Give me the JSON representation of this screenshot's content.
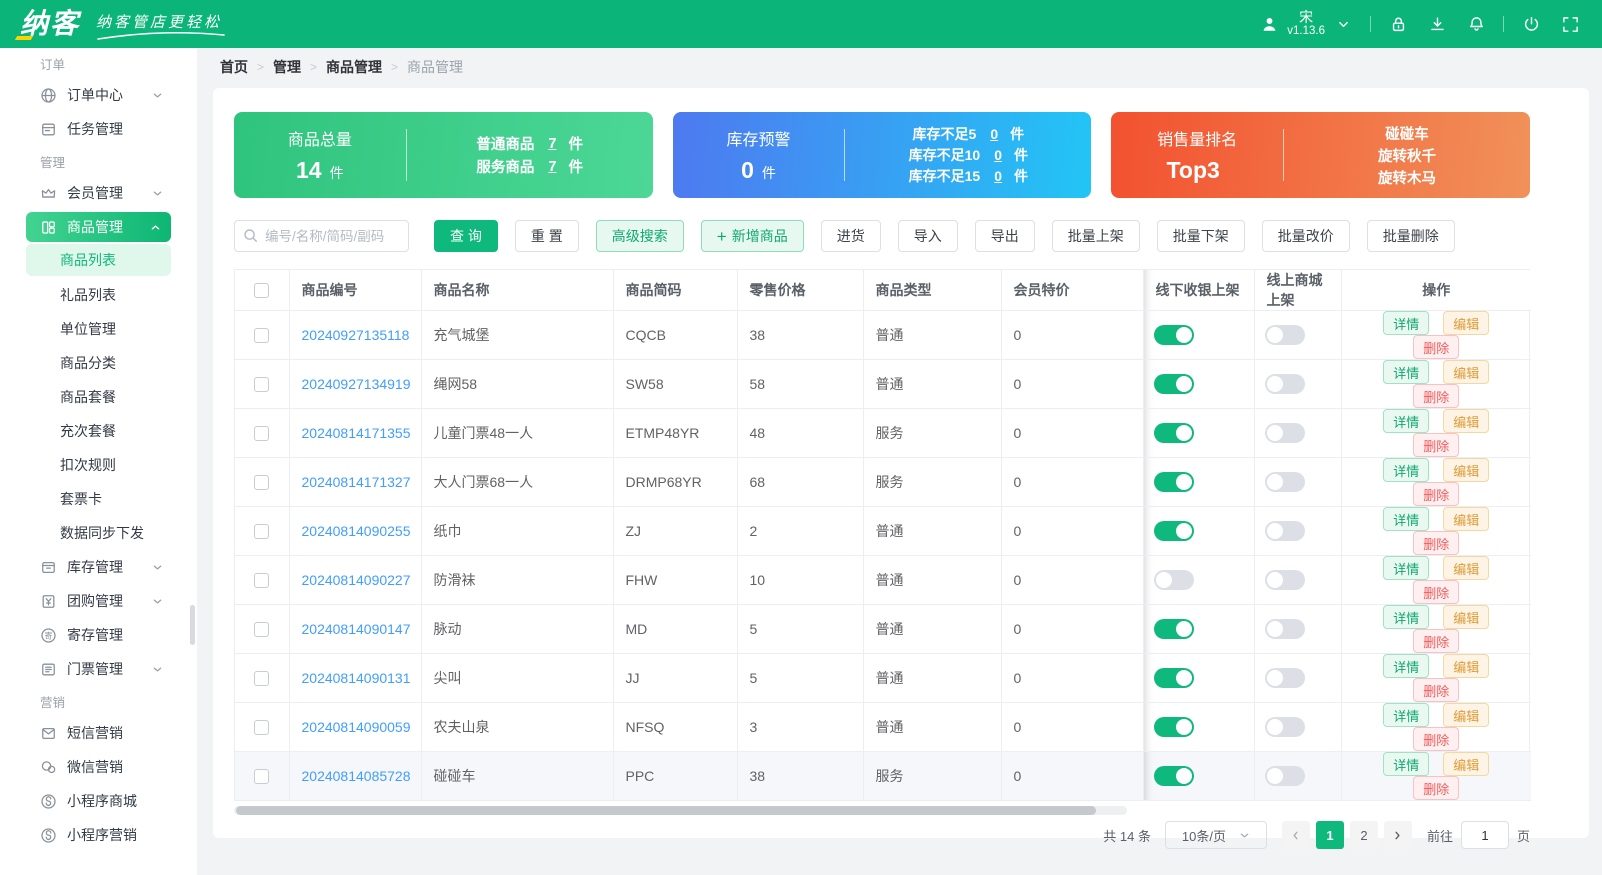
{
  "header": {
    "logo_text": "纳客",
    "tagline": "纳客管店更轻松",
    "username": "宋",
    "version": "v1.13.6"
  },
  "breadcrumb": {
    "items": [
      "首页",
      "管理",
      "商品管理",
      "商品管理"
    ]
  },
  "sidebar": {
    "sections": [
      {
        "label": "订单",
        "items": [
          {
            "key": "order-center",
            "icon": "order-center",
            "label": "订单中心",
            "arrow": "down"
          },
          {
            "key": "task-management",
            "icon": "task",
            "label": "任务管理"
          }
        ]
      },
      {
        "label": "管理",
        "items": [
          {
            "key": "member-management",
            "icon": "member",
            "label": "会员管理",
            "arrow": "down"
          },
          {
            "key": "goods-management",
            "icon": "goods",
            "label": "商品管理",
            "arrow": "up",
            "active": true,
            "children": [
              {
                "key": "goods-list",
                "label": "商品列表",
                "selected": true
              },
              {
                "key": "gift-list",
                "label": "礼品列表"
              },
              {
                "key": "unit-management",
                "label": "单位管理"
              },
              {
                "key": "goods-category",
                "label": "商品分类"
              },
              {
                "key": "goods-package",
                "label": "商品套餐"
              },
              {
                "key": "recharge-package",
                "label": "充次套餐"
              },
              {
                "key": "deduction-rules",
                "label": "扣次规则"
              },
              {
                "key": "ticket-card",
                "label": "套票卡"
              },
              {
                "key": "data-sync",
                "label": "数据同步下发"
              }
            ]
          },
          {
            "key": "stock-management",
            "icon": "stock",
            "label": "库存管理",
            "arrow": "down"
          },
          {
            "key": "groupbuy-management",
            "icon": "groupbuy",
            "label": "团购管理",
            "arrow": "down"
          },
          {
            "key": "deposit-management",
            "icon": "deposit",
            "label": "寄存管理"
          },
          {
            "key": "ticket-management",
            "icon": "ticket",
            "label": "门票管理",
            "arrow": "down"
          }
        ]
      },
      {
        "label": "营销",
        "items": [
          {
            "key": "sms-marketing",
            "icon": "sms",
            "label": "短信营销"
          },
          {
            "key": "wechat-marketing",
            "icon": "wechat",
            "label": "微信营销"
          },
          {
            "key": "miniapp-mall",
            "icon": "miniapp",
            "label": "小程序商城"
          },
          {
            "key": "miniapp-marketing",
            "icon": "miniapp",
            "label": "小程序营销"
          }
        ]
      }
    ]
  },
  "stats": {
    "total": {
      "title": "商品总量",
      "value": "14",
      "unit": "件",
      "lines": [
        {
          "label": "普通商品",
          "value": "7",
          "unit": "件"
        },
        {
          "label": "服务商品",
          "value": "7",
          "unit": "件"
        }
      ]
    },
    "warning": {
      "title": "库存预警",
      "value": "0",
      "unit": "件",
      "lines": [
        {
          "label": "库存不足5",
          "value": "0",
          "unit": "件"
        },
        {
          "label": "库存不足10",
          "value": "0",
          "unit": "件"
        },
        {
          "label": "库存不足15",
          "value": "0",
          "unit": "件"
        }
      ]
    },
    "top": {
      "title": "销售量排名",
      "value": "Top3",
      "lines": [
        {
          "label": "碰碰车"
        },
        {
          "label": "旋转秋千"
        },
        {
          "label": "旋转木马"
        }
      ]
    }
  },
  "toolbar": {
    "search_placeholder": "编号/名称/简码/副码",
    "buttons": [
      {
        "key": "query",
        "label": "查 询",
        "style": "primary"
      },
      {
        "key": "reset",
        "label": "重 置",
        "style": "default"
      },
      {
        "key": "advanced-search",
        "label": "高级搜索",
        "style": "light"
      },
      {
        "key": "add-product",
        "label": "新增商品",
        "style": "light",
        "icon": "plus"
      },
      {
        "key": "purchase",
        "label": "进货",
        "style": "default"
      },
      {
        "key": "import",
        "label": "导入",
        "style": "default"
      },
      {
        "key": "export",
        "label": "导出",
        "style": "default"
      },
      {
        "key": "batch-on-shelf",
        "label": "批量上架",
        "style": "default"
      },
      {
        "key": "batch-off-shelf",
        "label": "批量下架",
        "style": "default"
      },
      {
        "key": "batch-change-price",
        "label": "批量改价",
        "style": "default"
      },
      {
        "key": "batch-delete",
        "label": "批量删除",
        "style": "default"
      }
    ]
  },
  "table": {
    "columns": [
      "商品编号",
      "商品名称",
      "商品简码",
      "零售价格",
      "商品类型",
      "会员特价",
      "线下收银上架",
      "线上商城上架",
      "操作"
    ],
    "action_labels": [
      "详情",
      "编辑",
      "删除"
    ],
    "rows": [
      {
        "id": "20240927135118",
        "name": "充气城堡",
        "code": "CQCB",
        "price": "38",
        "type": "普通",
        "member_price": "0",
        "offline": true,
        "online": false
      },
      {
        "id": "20240927134919",
        "name": "绳网58",
        "code": "SW58",
        "price": "58",
        "type": "普通",
        "member_price": "0",
        "offline": true,
        "online": false
      },
      {
        "id": "20240814171355",
        "name": "儿童门票48一人",
        "code": "ETMP48YR",
        "price": "48",
        "type": "服务",
        "member_price": "0",
        "offline": true,
        "online": false
      },
      {
        "id": "20240814171327",
        "name": "大人门票68一人",
        "code": "DRMP68YR",
        "price": "68",
        "type": "服务",
        "member_price": "0",
        "offline": true,
        "online": false
      },
      {
        "id": "20240814090255",
        "name": "纸巾",
        "code": "ZJ",
        "price": "2",
        "type": "普通",
        "member_price": "0",
        "offline": true,
        "online": false
      },
      {
        "id": "20240814090227",
        "name": "防滑袜",
        "code": "FHW",
        "price": "10",
        "type": "普通",
        "member_price": "0",
        "offline": false,
        "online": false
      },
      {
        "id": "20240814090147",
        "name": "脉动",
        "code": "MD",
        "price": "5",
        "type": "普通",
        "member_price": "0",
        "offline": true,
        "online": false
      },
      {
        "id": "20240814090131",
        "name": "尖叫",
        "code": "JJ",
        "price": "5",
        "type": "普通",
        "member_price": "0",
        "offline": true,
        "online": false
      },
      {
        "id": "20240814090059",
        "name": "农夫山泉",
        "code": "NFSQ",
        "price": "3",
        "type": "普通",
        "member_price": "0",
        "offline": true,
        "online": false
      },
      {
        "id": "20240814085728",
        "name": "碰碰车",
        "code": "PPC",
        "price": "38",
        "type": "服务",
        "member_price": "0",
        "offline": true,
        "online": false,
        "highlight": true
      }
    ]
  },
  "pagination": {
    "total_text": "共 14 条",
    "page_size": "10条/页",
    "pages": [
      "1",
      "2"
    ],
    "current": "1",
    "goto_label": "前往",
    "goto_value": "1",
    "page_label": "页"
  }
}
